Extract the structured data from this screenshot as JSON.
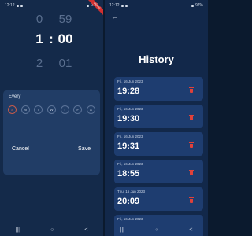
{
  "left_screen": {
    "status": {
      "time": "12:12",
      "right": "97%"
    },
    "picker": {
      "hour_prev": "0",
      "minute_prev": "59",
      "hour": "1",
      "separator": ":",
      "minute": "00",
      "hour_next": "2",
      "minute_next": "01"
    },
    "repeat": {
      "label": "Every",
      "days": [
        {
          "label": "S",
          "active": true
        },
        {
          "label": "M",
          "active": false
        },
        {
          "label": "T",
          "active": false
        },
        {
          "label": "W",
          "active": false
        },
        {
          "label": "T",
          "active": false
        },
        {
          "label": "F",
          "active": false
        },
        {
          "label": "S",
          "active": false
        }
      ]
    },
    "cancel_label": "Cancel",
    "save_label": "Save"
  },
  "right_screen": {
    "status": {
      "time": "12:12",
      "right": "97%"
    },
    "back_glyph": "←",
    "title": "History",
    "entries": [
      {
        "date": "Fri, 16 Jun 2023",
        "time": "19:28"
      },
      {
        "date": "Fri, 16 Jun 2023",
        "time": "19:30"
      },
      {
        "date": "Fri, 16 Jun 2023",
        "time": "19:31"
      },
      {
        "date": "Fri, 16 Jun 2023",
        "time": "18:55"
      },
      {
        "date": "Thu, 15 Jun 2023",
        "time": "20:09"
      },
      {
        "date": "Fri, 16 Jun 2023",
        "time": ""
      }
    ]
  },
  "navbar": {
    "recents": "|||",
    "home": "○",
    "back": "<"
  },
  "colors": {
    "background": "#142a4a",
    "card": "#213d66",
    "entry": "#1e3d70",
    "delete": "#e0413a",
    "active_day": "#d66b5a"
  },
  "icons": [
    "back-arrow-icon",
    "trash-icon",
    "battery-icon",
    "wifi-icon"
  ]
}
